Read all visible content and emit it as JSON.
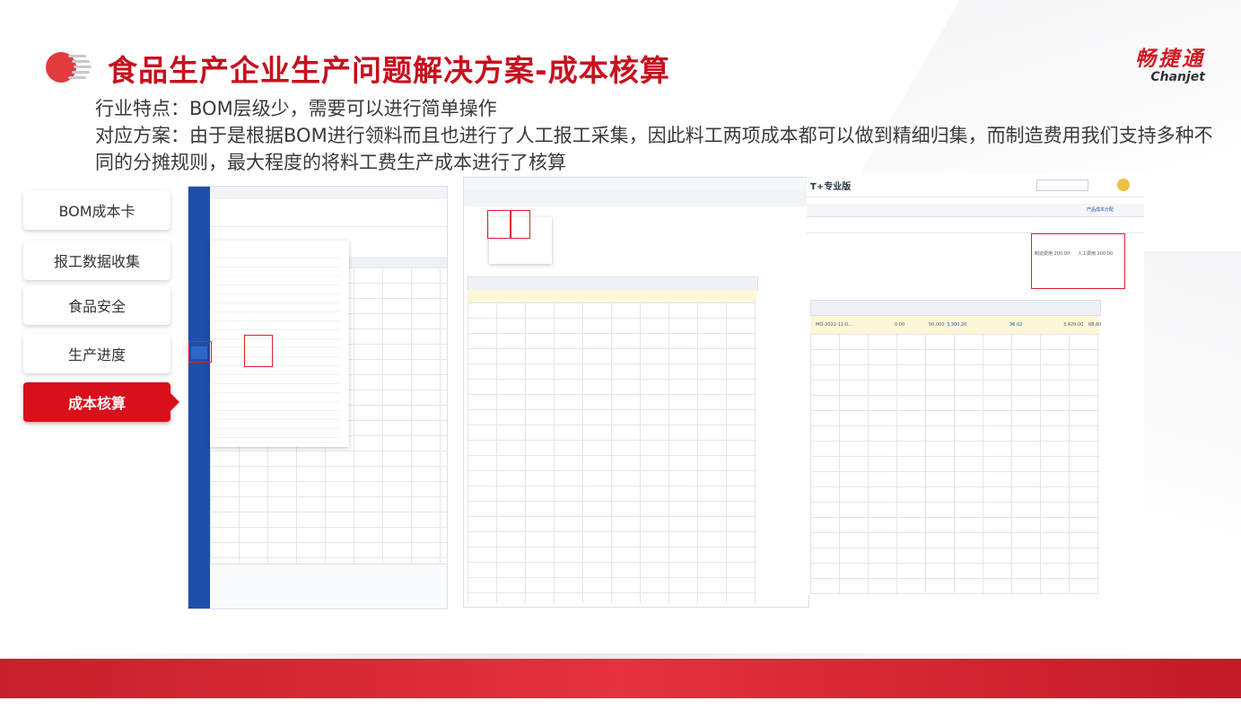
{
  "slide": {
    "title": "食品生产企业生产问题解决方案-成本核算",
    "brand_cn": "畅捷通",
    "brand_en": "Chanjet",
    "line1": "行业特点：BOM层级少，需要可以进行简单操作",
    "line2": "对应方案：由于是根据BOM进行领料而且也进行了人工报工采集，因此料工两项成本都可以做到精细归集，而制造费用我们支持多种不同的分摊规则，最大程度的将料工费生产成本进行了核算"
  },
  "nav": {
    "items": [
      {
        "label": "BOM成本卡",
        "active": false
      },
      {
        "label": "报工数据收集",
        "active": false
      },
      {
        "label": "食品安全",
        "active": false
      },
      {
        "label": "生产进度",
        "active": false
      },
      {
        "label": "成本核算",
        "active": true
      }
    ]
  },
  "screenshots": {
    "right": {
      "app_name": "T+专业版",
      "tab_active": "产品成本分配",
      "field_mfg": "制造费用 200.00",
      "field_labor": "人工费用 200.00",
      "row_code": "MO-2022-11-0...",
      "row_qty": "0.00",
      "row_val1": "50.000",
      "row_val2": "3,300.20",
      "row_val3": "36.02",
      "row_val4": "3,429.00",
      "row_val5": "68.60"
    }
  },
  "colors": {
    "brand_red": "#c8101e",
    "nav_active": "#d7101c",
    "sidebar_blue": "#1f4fa8"
  }
}
